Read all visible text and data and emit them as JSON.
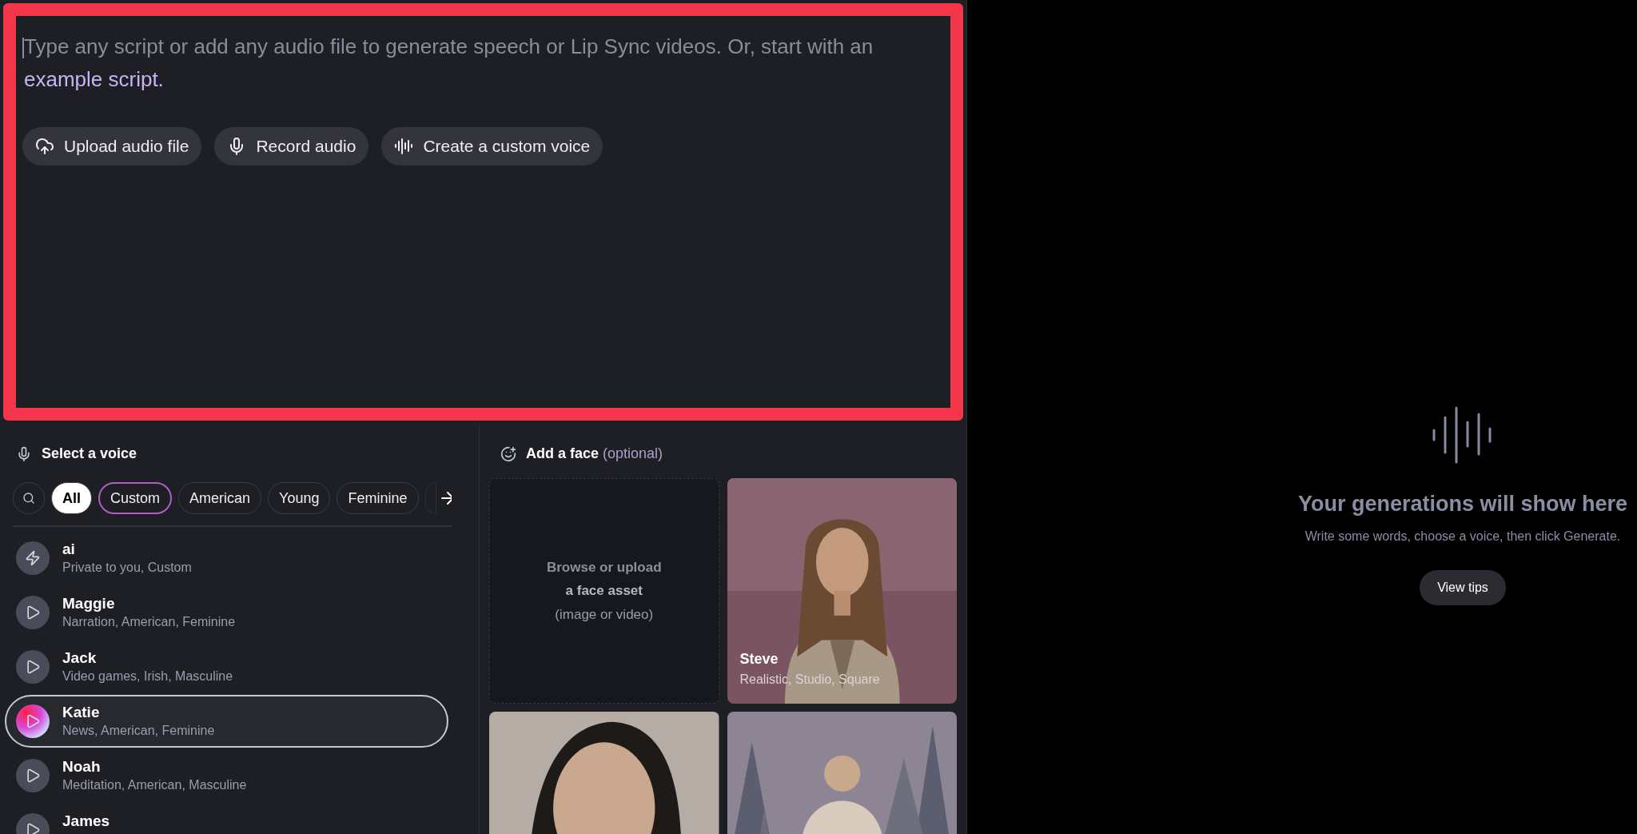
{
  "script": {
    "placeholder": "Type any script or add any audio file to generate speech or Lip Sync videos. Or, start with an",
    "link": "example script.",
    "actions": [
      {
        "label": "Upload audio file",
        "kind": "upload"
      },
      {
        "label": "Record audio",
        "kind": "record"
      },
      {
        "label": "Create a custom voice",
        "kind": "voice"
      }
    ]
  },
  "voice_panel": {
    "title": "Select a voice",
    "filters": [
      {
        "label": "All",
        "selected": true,
        "kind": "tag"
      },
      {
        "label": "Custom",
        "selected": false,
        "kind": "custom"
      },
      {
        "label": "American",
        "selected": false,
        "kind": "tag"
      },
      {
        "label": "Young",
        "selected": false,
        "kind": "tag"
      },
      {
        "label": "Feminine",
        "selected": false,
        "kind": "tag"
      }
    ],
    "voices": [
      {
        "name": "ai",
        "tags": "Private to you, Custom",
        "kind": "custom",
        "selected": false
      },
      {
        "name": "Maggie",
        "tags": "Narration, American, Feminine",
        "kind": "preset",
        "selected": false
      },
      {
        "name": "Jack",
        "tags": "Video games, Irish, Masculine",
        "kind": "preset",
        "selected": false
      },
      {
        "name": "Katie",
        "tags": "News, American, Feminine",
        "kind": "preset",
        "selected": true
      },
      {
        "name": "Noah",
        "tags": "Meditation, American, Masculine",
        "kind": "preset",
        "selected": false
      },
      {
        "name": "James",
        "kind": "preset",
        "selected": false
      }
    ]
  },
  "face_panel": {
    "title": "Add a face",
    "title_note": "(optional)",
    "upload": {
      "line1": "**Browse** or **upload**",
      "line2": "a face asset",
      "line3": "(image or video)"
    },
    "faces": [
      {
        "name": "Steve",
        "tags": "Realistic, Studio, Square",
        "kind": "picture"
      },
      {
        "kind": "picture"
      },
      {
        "kind": "picture"
      }
    ]
  },
  "output": {
    "title": "Your generations will show here",
    "subtitle": "Write some words, choose a voice, then click Generate.",
    "button": "View tips"
  }
}
